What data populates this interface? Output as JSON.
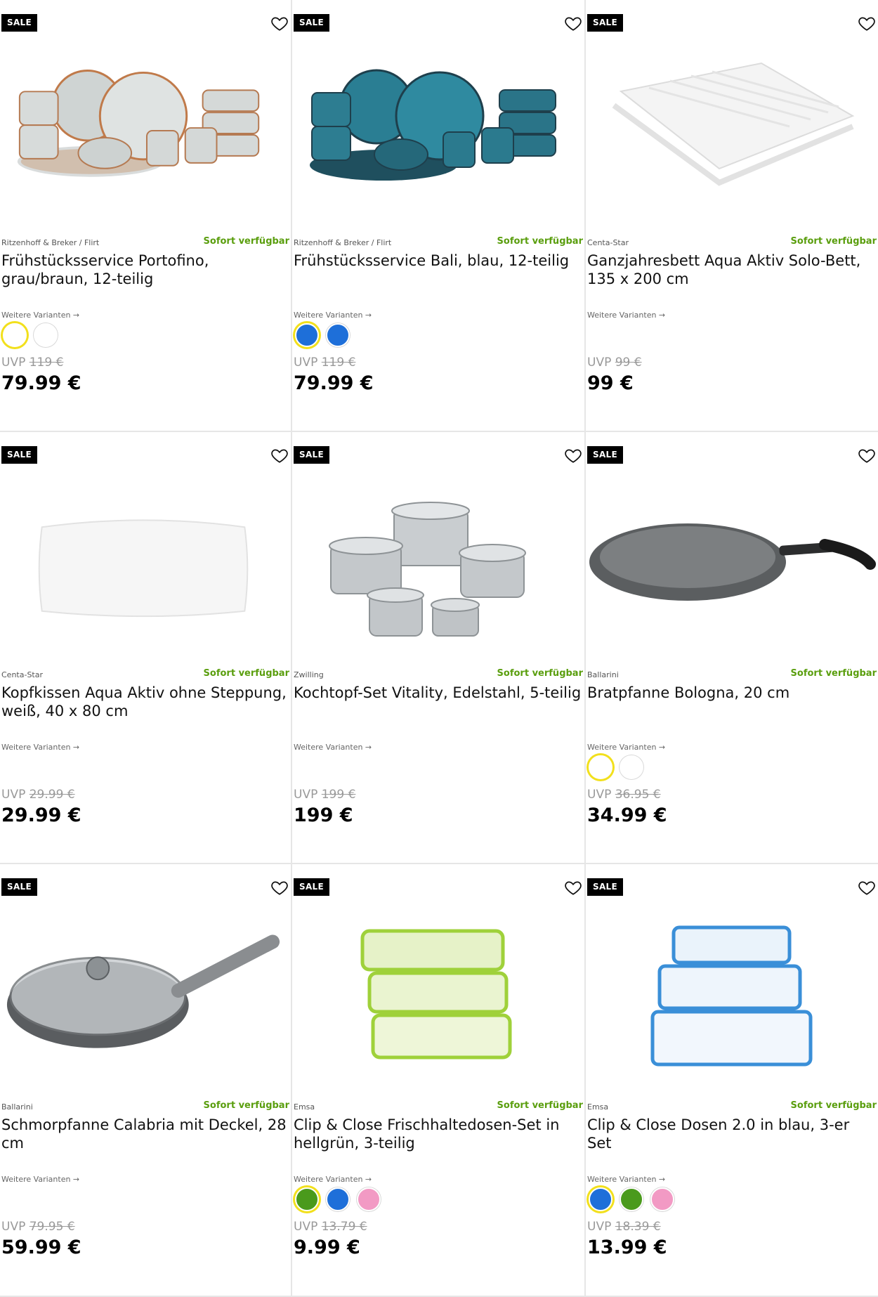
{
  "badge_label": "SALE",
  "availability_label": "Sofort verfügbar",
  "variants_label": "Weitere Varianten →",
  "uvp_label": "UVP",
  "colors": {
    "availability": "#5a9e0e",
    "selected_ring": "#f2e01c"
  },
  "products": [
    {
      "brand": "Ritzenhoff & Breker / Flirt",
      "title": "Frühstücksservice Portofino, grau/braun, 12-teilig",
      "uvp": "119 €",
      "price": "79.99 €",
      "swatches": [
        "#ffffff",
        "#ffffff"
      ],
      "selected": 0,
      "icon": "tableware-set-grey-icon"
    },
    {
      "brand": "Ritzenhoff & Breker / Flirt",
      "title": "Frühstücksservice Bali, blau, 12-teilig",
      "uvp": "119 €",
      "price": "79.99 €",
      "swatches": [
        "#1e6fd9",
        "#1e6fd9"
      ],
      "selected": 0,
      "icon": "tableware-set-blue-icon"
    },
    {
      "brand": "Centa-Star",
      "title": "Ganzjahresbett Aqua Aktiv Solo-Bett, 135 x 200 cm",
      "uvp": "99 €",
      "price": "99 €",
      "swatches": [],
      "selected": -1,
      "icon": "duvet-icon"
    },
    {
      "brand": "Centa-Star",
      "title": "Kopfkissen Aqua Aktiv ohne Steppung, weiß, 40 x 80 cm",
      "uvp": "29.99 €",
      "price": "29.99 €",
      "swatches": [],
      "selected": -1,
      "icon": "pillow-icon"
    },
    {
      "brand": "Zwilling",
      "title": "Kochtopf-Set Vitality, Edelstahl, 5-teilig",
      "uvp": "199 €",
      "price": "199 €",
      "swatches": [],
      "selected": -1,
      "icon": "cookware-set-icon"
    },
    {
      "brand": "Ballarini",
      "title": "Bratpfanne Bologna, 20 cm",
      "uvp": "36.95 €",
      "price": "34.99 €",
      "swatches": [
        "#ffffff",
        "#ffffff"
      ],
      "selected": 0,
      "icon": "frying-pan-icon"
    },
    {
      "brand": "Ballarini",
      "title": "Schmorpfanne Calabria mit Deckel, 28 cm",
      "uvp": "79.95 €",
      "price": "59.99 €",
      "swatches": [],
      "selected": -1,
      "icon": "braising-pan-icon"
    },
    {
      "brand": "Emsa",
      "title": "Clip & Close Frischhaltedosen-Set in hellgrün, 3-teilig",
      "uvp": "13.79 €",
      "price": "9.99 €",
      "swatches": [
        "#4a9a1c",
        "#1e6fd9",
        "#f29ac4"
      ],
      "selected": 0,
      "icon": "food-containers-green-icon"
    },
    {
      "brand": "Emsa",
      "title": "Clip & Close Dosen 2.0 in blau, 3-er Set",
      "uvp": "18.39 €",
      "price": "13.99 €",
      "swatches": [
        "#1e6fd9",
        "#4a9a1c",
        "#f29ac4"
      ],
      "selected": 0,
      "icon": "food-containers-blue-icon"
    }
  ]
}
